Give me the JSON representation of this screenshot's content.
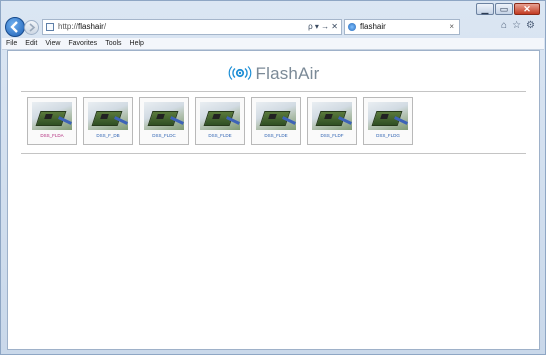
{
  "browser": {
    "address_url_prefix": "http://",
    "address_url_host": "flashair",
    "address_url_suffix": "/",
    "address_controls": "ρ ▾ → ✕",
    "tab_title": "flashair",
    "tab_close": "×"
  },
  "menu": [
    "File",
    "Edit",
    "View",
    "Favorites",
    "Tools",
    "Help"
  ],
  "page": {
    "logo_text": "FlashAir",
    "thumbnails": [
      {
        "caption": "DSS_FLDA"
      },
      {
        "caption": "DSS_F_DB"
      },
      {
        "caption": "DSS_FLDC"
      },
      {
        "caption": "DSS_FLDE"
      },
      {
        "caption": "DSS_FLDE"
      },
      {
        "caption": "DSS_FLDF"
      },
      {
        "caption": "DSS_FLDG"
      }
    ]
  },
  "colors": {
    "link": "#2a5fb0",
    "visited_link": "#b0267a",
    "logo_gray": "#7b8a97"
  }
}
